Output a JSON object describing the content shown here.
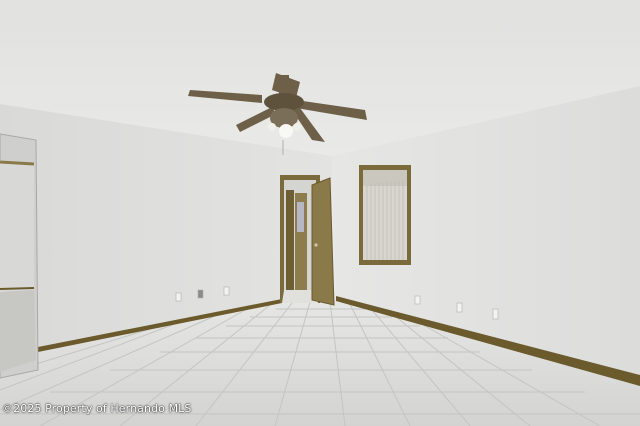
{
  "watermark": {
    "text": "©2025 Property of Hernando MLS"
  },
  "scene": {
    "room": "empty-room",
    "objects": [
      "ceiling-fan",
      "open-door",
      "window-with-vertical-blinds",
      "floor-mirror",
      "tile-floor",
      "baseboards",
      "electrical-outlets"
    ]
  },
  "colors": {
    "ceiling": "#e6e6e5",
    "back_wall": "#e2e2e1",
    "right_wall": "#e4e4e3",
    "left_wall": "#dfdfde",
    "floor_tile": "#d9dad7",
    "grout": "#bdbdba",
    "baseboard": "#6b5a2c",
    "door": "#8a7a4a",
    "window_frame": "#7a6a3c",
    "blinds": "#d8d6cf",
    "fan_blade": "#6e6048"
  }
}
